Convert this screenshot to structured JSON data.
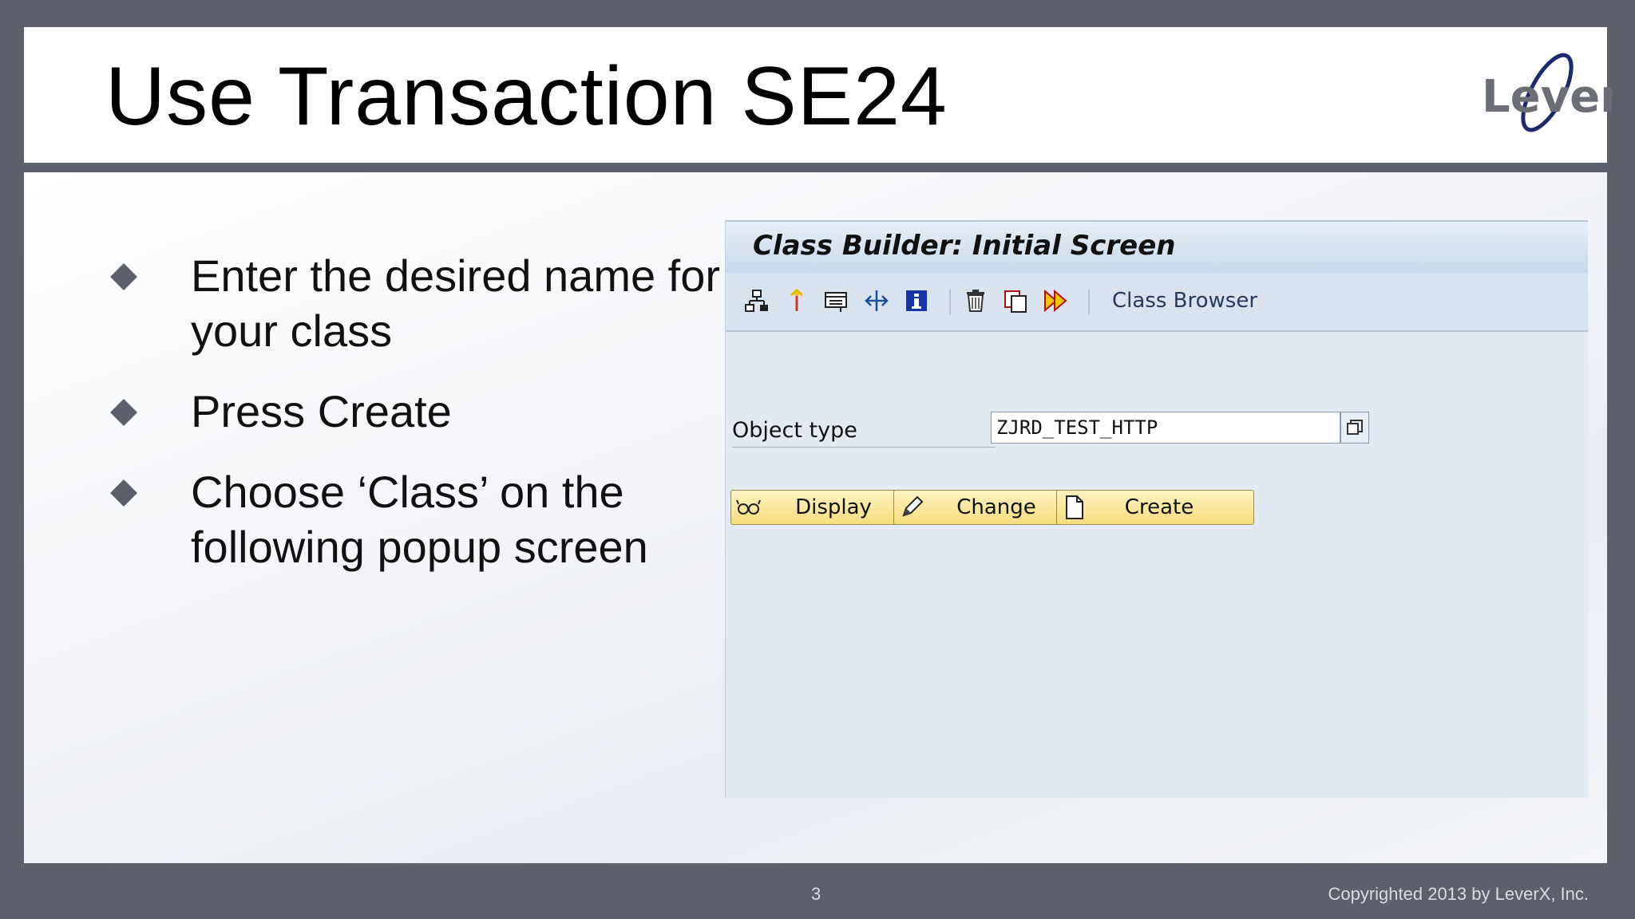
{
  "slide": {
    "title": "Use Transaction SE24",
    "logo_text": "LeverX",
    "bullets": [
      "Enter the desired name for your class",
      "Press Create",
      "Choose ‘Class’ on the following popup screen"
    ],
    "page_number": "3",
    "copyright": "Copyrighted 2013 by LeverX, Inc."
  },
  "sap": {
    "title": "Class Builder: Initial Screen",
    "toolbar": {
      "icons": [
        "hierarchy-icon",
        "where-used-icon",
        "display-object-list-icon",
        "move-icon",
        "info-icon",
        "delete-icon",
        "copy-icon",
        "activate-icon"
      ],
      "class_browser_label": "Class Browser"
    },
    "object_type_label": "Object type",
    "object_type_value": "ZJRD_TEST_HTTP",
    "buttons": {
      "display": "Display",
      "change": "Change",
      "create": "Create"
    }
  },
  "colors": {
    "frame": "#5b606b",
    "sap_background": "#e4eaf2",
    "button_yellow": "#f6dd7c",
    "logo_blue": "#1e2a6e"
  }
}
